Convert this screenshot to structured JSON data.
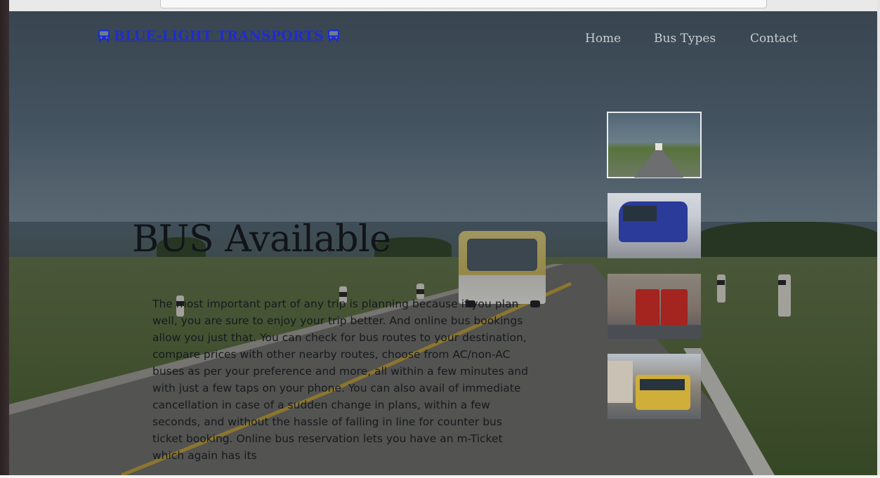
{
  "brand": {
    "title": "BLUE-LIGHT TRANSPORTS"
  },
  "nav": {
    "items": [
      {
        "label": "Home"
      },
      {
        "label": "Bus Types"
      },
      {
        "label": "Contact"
      }
    ]
  },
  "hero": {
    "heading": "BUS Available",
    "paragraph": "The most important part of any trip is planning because if you plan well, you are sure to enjoy your trip better. And online bus bookings allow you just that. You can check for bus routes to your destination, compare prices with other nearby routes, choose from AC/non-AC buses as per your preference and more, all within a few minutes and with just a few taps on your phone. You can also avail of immediate cancellation in case of a sudden change in plans, within a few seconds, and without the hassle of falling in line for counter bus ticket booking. Online bus reservation lets you have an m-Ticket which again has its"
  },
  "gallery": {
    "thumbnails": [
      {
        "label": "road"
      },
      {
        "label": "coach"
      },
      {
        "label": "double-decker"
      },
      {
        "label": "city-bus"
      }
    ]
  },
  "colors": {
    "brand": "#1f2ccf",
    "nav_text": "#c9ccd1",
    "heading": "#111418"
  },
  "icons": [
    "bus-icon"
  ]
}
